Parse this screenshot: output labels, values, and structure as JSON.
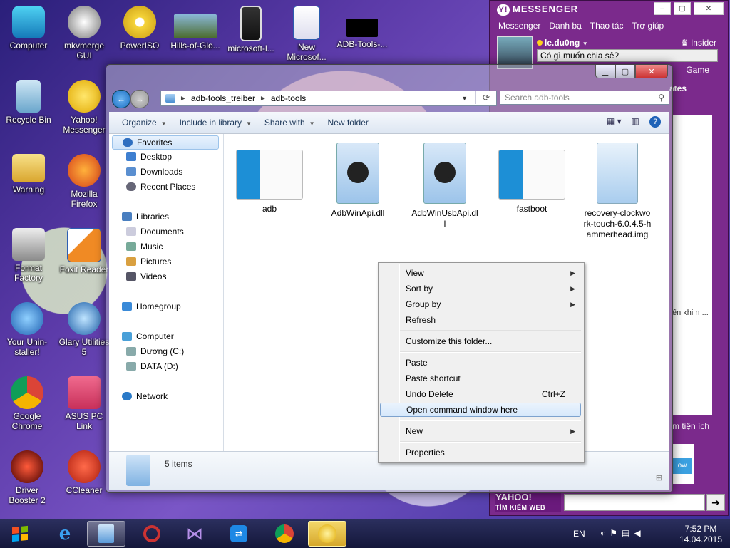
{
  "desktop": {
    "icons": [
      {
        "label": "Computer"
      },
      {
        "label": "mkvmerge GUI"
      },
      {
        "label": "PowerISO"
      },
      {
        "label": "Hills-of-Glo..."
      },
      {
        "label": "microsoft-l..."
      },
      {
        "label": "New Microsof..."
      },
      {
        "label": "ADB-Tools-..."
      },
      {
        "label": "Recycle Bin"
      },
      {
        "label": "Yahoo! Messenger"
      },
      {
        "label": "Warning"
      },
      {
        "label": "Mozilla Firefox"
      },
      {
        "label": "Format Factory"
      },
      {
        "label": "Foxit Reader"
      },
      {
        "label": "Your Unin-staller!"
      },
      {
        "label": "Glary Utilities 5"
      },
      {
        "label": "Google Chrome"
      },
      {
        "label": "ASUS PC Link"
      },
      {
        "label": "Driver Booster 2"
      },
      {
        "label": "CCleaner"
      }
    ]
  },
  "explorer": {
    "breadcrumb": [
      "adb-tools_treiber",
      "adb-tools"
    ],
    "search_placeholder": "Search adb-tools",
    "toolbar": {
      "organize": "Organize",
      "include": "Include in library",
      "share": "Share with",
      "new_folder": "New folder"
    },
    "nav": {
      "favorites": "Favorites",
      "desktop": "Desktop",
      "downloads": "Downloads",
      "recent": "Recent Places",
      "libraries": "Libraries",
      "documents": "Documents",
      "music": "Music",
      "pictures": "Pictures",
      "videos": "Videos",
      "homegroup": "Homegroup",
      "computer": "Computer",
      "drive_c": "Dương (C:)",
      "drive_d": "DATA (D:)",
      "network": "Network"
    },
    "files": [
      {
        "name": "adb"
      },
      {
        "name": "AdbWinApi.dll"
      },
      {
        "name": "AdbWinUsbApi.dll"
      },
      {
        "name": "fastboot"
      },
      {
        "name": "recovery-clockwork-touch-6.0.4.5-hammerhead.img"
      }
    ],
    "status": "5 items"
  },
  "context_menu": {
    "view": "View",
    "sort_by": "Sort by",
    "group_by": "Group by",
    "refresh": "Refresh",
    "customize": "Customize this folder...",
    "paste": "Paste",
    "paste_shortcut": "Paste shortcut",
    "undo_delete": "Undo Delete",
    "undo_shortcut": "Ctrl+Z",
    "open_cmd": "Open command window here",
    "new": "New",
    "properties": "Properties"
  },
  "yahoo": {
    "title": "MESSENGER",
    "menu": [
      "Messenger",
      "Danh bạ",
      "Thao tác",
      "Trợ giúp"
    ],
    "username": "le.du0ng",
    "insider": "Insider",
    "status_placeholder": "Có gì muốn chia sẻ?",
    "game": "Game",
    "ates": "ates",
    "peek1": "ến khi n ...",
    "peek2": "m tiện ích",
    "now": "ow",
    "search_logo": "YAHOO!",
    "search_sub": "TÌM KIẾM WEB"
  },
  "taskbar": {
    "lang": "EN",
    "time": "7:52 PM",
    "date": "14.04.2015"
  },
  "colors": {
    "accent": "#1d6fc4",
    "yahoo_purple": "#7b2a8c",
    "highlight": "#d6e8fb"
  }
}
